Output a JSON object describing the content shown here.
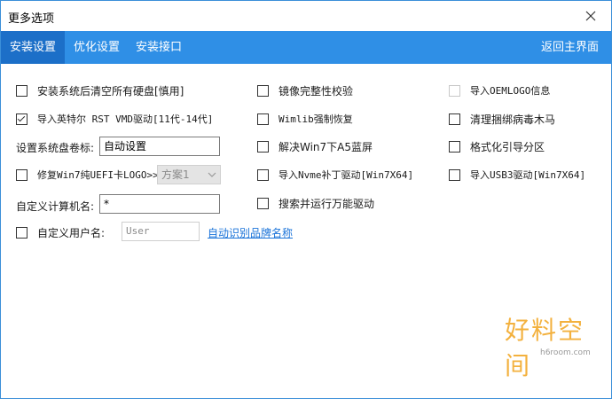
{
  "window": {
    "title": "更多选项"
  },
  "tabs": [
    {
      "label": "安装设置",
      "active": true
    },
    {
      "label": "优化设置",
      "active": false
    },
    {
      "label": "安装接口",
      "active": false
    }
  ],
  "back_label": "返回主界面",
  "options": {
    "clear_disks": {
      "label": "安装系统后清空所有硬盘[慎用]",
      "checked": false
    },
    "intel_rst": {
      "label": "导入英特尔 RST VMD驱动[11代-14代]",
      "checked": true
    },
    "volume_label": {
      "label": "设置系统盘卷标:",
      "value": "自动设置"
    },
    "fix_uefi_logo": {
      "label": "修复Win7纯UEFI卡LOGO>>",
      "checked": false,
      "scheme": "方案1"
    },
    "computer_name": {
      "label": "自定义计算机名:",
      "value": "*"
    },
    "user_name": {
      "label": "自定义用户名:",
      "checked": false,
      "placeholder": "User"
    },
    "auto_brand_link": "自动识别品牌名称",
    "image_integrity": {
      "label": "镜像完整性校验",
      "checked": false
    },
    "wimlib_restore": {
      "label": "Wimlib强制恢复",
      "checked": false
    },
    "fix_a5_bsod": {
      "label": "解决Win7下A5蓝屏",
      "checked": false
    },
    "nvme_patch": {
      "label": "导入Nvme补丁驱动[Win7X64]",
      "checked": false
    },
    "search_driver": {
      "label": "搜索并运行万能驱动",
      "checked": false
    },
    "oem_logo": {
      "label": "导入OEMLOGO信息",
      "checked": false,
      "disabled": true
    },
    "clean_trojan": {
      "label": "清理捆绑病毒木马",
      "checked": false
    },
    "format_boot": {
      "label": "格式化引导分区",
      "checked": false
    },
    "usb3_driver": {
      "label": "导入USB3驱动[Win7X64]",
      "checked": false
    }
  },
  "watermark": {
    "brand": "好料空间",
    "url": "h6room.com"
  }
}
